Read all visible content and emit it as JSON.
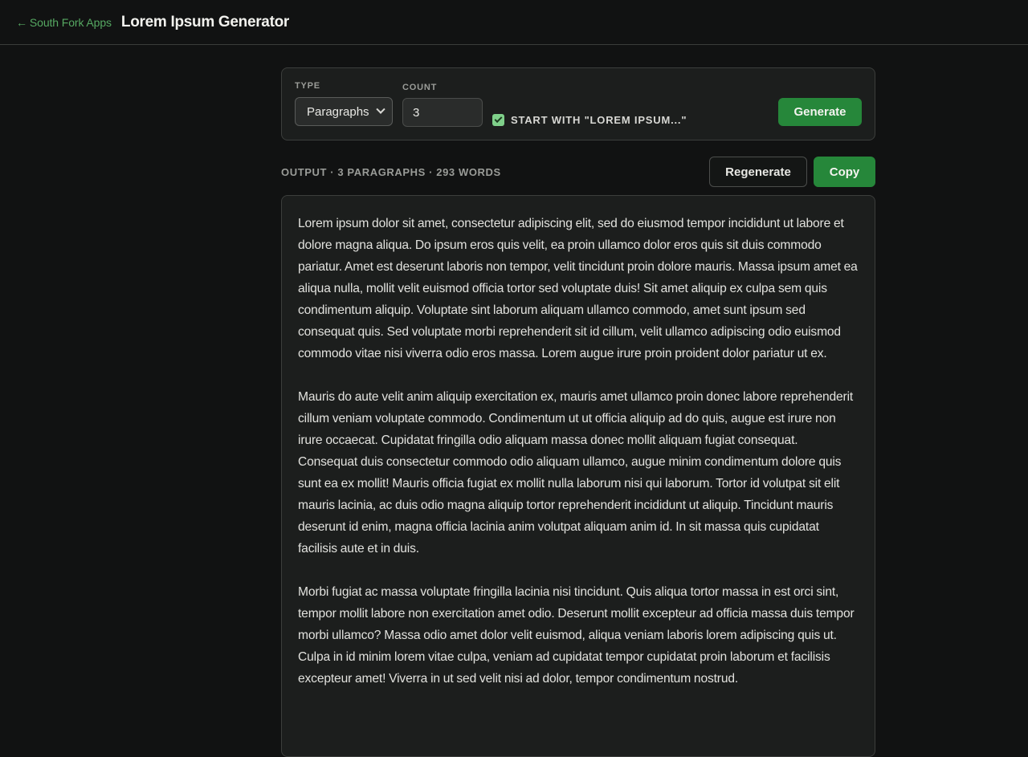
{
  "header": {
    "back_arrow": "←",
    "back_label": "South Fork Apps",
    "title": "Lorem Ipsum Generator"
  },
  "controls": {
    "type_label": "TYPE",
    "type_value": "Paragraphs",
    "count_label": "COUNT",
    "count_value": "3",
    "start_with_checked": true,
    "start_with_label": "START WITH \"LOREM IPSUM...\"",
    "generate_label": "Generate"
  },
  "output": {
    "meta": "OUTPUT · 3 PARAGRAPHS · 293 WORDS",
    "regenerate_label": "Regenerate",
    "copy_label": "Copy",
    "paragraphs": [
      "Lorem ipsum dolor sit amet, consectetur adipiscing elit, sed do eiusmod tempor incididunt ut labore et dolore magna aliqua. Do ipsum eros quis velit, ea proin ullamco dolor eros quis sit duis commodo pariatur. Amet est deserunt laboris non tempor, velit tincidunt proin dolore mauris. Massa ipsum amet ea aliqua nulla, mollit velit euismod officia tortor sed voluptate duis! Sit amet aliquip ex culpa sem quis condimentum aliquip. Voluptate sint laborum aliquam ullamco commodo, amet sunt ipsum sed consequat quis. Sed voluptate morbi reprehenderit sit id cillum, velit ullamco adipiscing odio euismod commodo vitae nisi viverra odio eros massa. Lorem augue irure proin proident dolor pariatur ut ex.",
      "Mauris do aute velit anim aliquip exercitation ex, mauris amet ullamco proin donec labore reprehenderit cillum veniam voluptate commodo. Condimentum ut ut officia aliquip ad do quis, augue est irure non irure occaecat. Cupidatat fringilla odio aliquam massa donec mollit aliquam fugiat consequat. Consequat duis consectetur commodo odio aliquam ullamco, augue minim condimentum dolore quis sunt ea ex mollit! Mauris officia fugiat ex mollit nulla laborum nisi qui laborum. Tortor id volutpat sit elit mauris lacinia, ac duis odio magna aliquip tortor reprehenderit incididunt ut aliquip. Tincidunt mauris deserunt id enim, magna officia lacinia anim volutpat aliquam anim id. In sit massa quis cupidatat facilisis aute et in duis.",
      "Morbi fugiat ac massa voluptate fringilla lacinia nisi tincidunt. Quis aliqua tortor massa in est orci sint, tempor mollit labore non exercitation amet odio. Deserunt mollit excepteur ad officia massa duis tempor morbi ullamco? Massa odio amet dolor velit euismod, aliqua veniam laboris lorem adipiscing quis ut. Culpa in id minim lorem vitae culpa, veniam ad cupidatat tempor cupidatat proin laborum et facilisis excepteur amet! Viverra in ut sed velit nisi ad dolor, tempor condimentum nostrud."
    ]
  },
  "colors": {
    "background": "#111212",
    "panel": "#1c1e1d",
    "accent_green": "#26873a",
    "link_green": "#56a862",
    "checkbox_green": "#7fd08a"
  }
}
